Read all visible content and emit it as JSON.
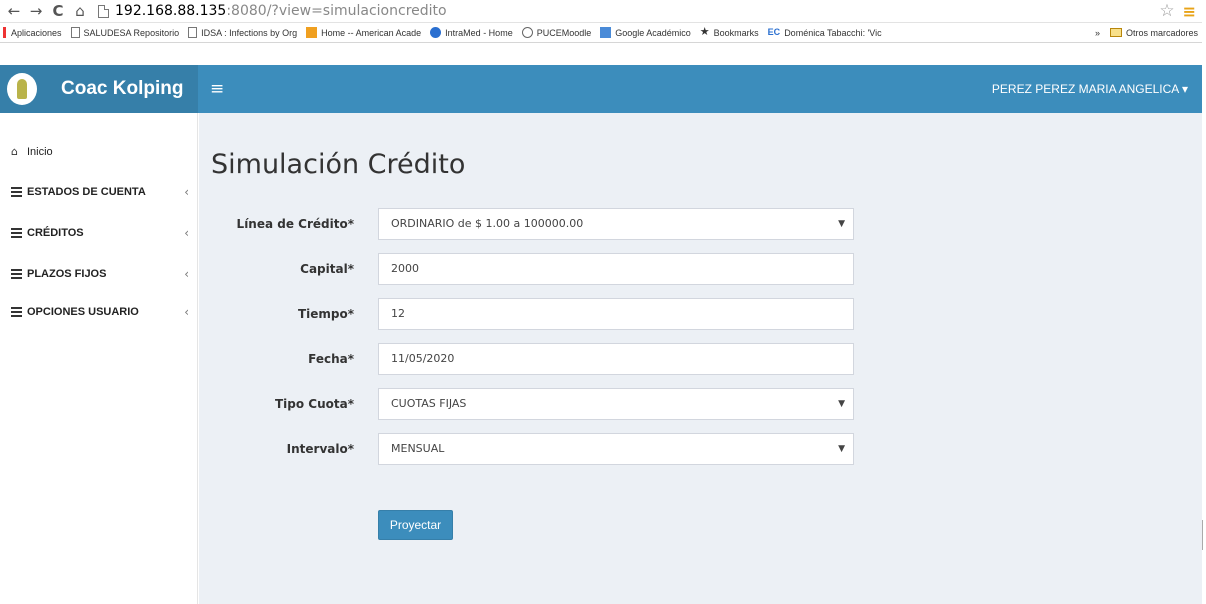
{
  "browser": {
    "back": "←",
    "forward": "→",
    "reload": "C",
    "home": "⌂",
    "url_host": "192.168.88.135",
    "url_rest": ":8080/?view=simulacioncredito",
    "star": "☆",
    "menu": "≡"
  },
  "bookmarks": [
    "Aplicaciones",
    "SALUDESA Repositorio",
    "IDSA : Infections by Org",
    "Home -- American Acade",
    "IntraMed - Home",
    "PUCEMoodle",
    "Google Académico",
    "Bookmarks",
    "Doménica Tabacchi: 'Vic"
  ],
  "bookmarks_more": "»",
  "bookmarks_other": "Otros marcadores",
  "header": {
    "brand": "Coac Kolping",
    "hamburger": "≡",
    "user": "PEREZ PEREZ MARIA ANGELICA ▾"
  },
  "sidebar": {
    "items": [
      {
        "label": "Inicio"
      },
      {
        "label": "ESTADOS DE CUENTA",
        "chevron": "‹"
      },
      {
        "label": "CRÉDITOS",
        "chevron": "‹"
      },
      {
        "label": "PLAZOS FIJOS",
        "chevron": "‹"
      },
      {
        "label": "OPCIONES USUARIO",
        "chevron": "‹"
      }
    ]
  },
  "main": {
    "title": "Simulación Crédito",
    "fields": [
      {
        "label": "Línea de Crédito*",
        "value": "ORDINARIO de $ 1.00 a 100000.00",
        "type": "select"
      },
      {
        "label": "Capital*",
        "value": "2000",
        "type": "input"
      },
      {
        "label": "Tiempo*",
        "value": "12",
        "type": "input"
      },
      {
        "label": "Fecha*",
        "value": "11/05/2020",
        "type": "input"
      },
      {
        "label": "Tipo Cuota*",
        "value": "CUOTAS FIJAS",
        "type": "select"
      },
      {
        "label": "Intervalo*",
        "value": "MENSUAL",
        "type": "select"
      }
    ],
    "submit": "Proyectar",
    "select_arrow": "▼"
  },
  "colors": {
    "header": "#3c8dbc",
    "brand_bg": "#367fa9",
    "content_bg": "#ecf0f5"
  }
}
